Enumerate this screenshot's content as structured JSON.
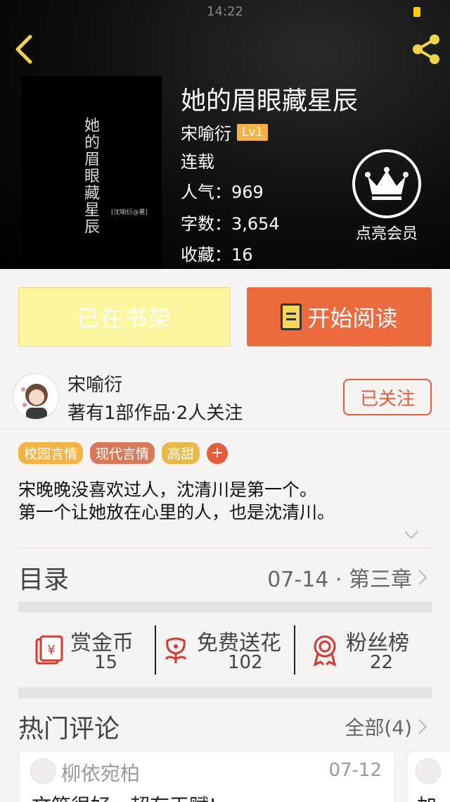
{
  "status_bar": {
    "time": "14:22"
  },
  "header": {
    "back_icon": "chevron-left-icon",
    "share_icon": "share-icon",
    "cover": {
      "title": "她的眉眼藏星辰",
      "author_text": "[沈喻衍@著]"
    },
    "title": "她的眉眼藏星辰",
    "author": "宋喻衍",
    "level": "Lv1",
    "status": "连载",
    "popularity": "人气：969",
    "word_count": "字数：3,654",
    "favorites": "收藏：16",
    "vip_label": "点亮会员",
    "vip_icon": "crown-icon"
  },
  "actions": {
    "shelf_label": "已在书架",
    "read_label": "开始阅读"
  },
  "author_row": {
    "name": "宋喻衍",
    "stats": "著有1部作品·2人关注",
    "follow_label": "已关注"
  },
  "tags": [
    {
      "label": "校园言情",
      "color": "#f4b345"
    },
    {
      "label": "现代言情",
      "color": "#d77a5c"
    },
    {
      "label": "高甜",
      "color": "#e7b94c"
    }
  ],
  "tag_add": "+",
  "synopsis": {
    "line1": "宋晚晚没喜欢过人，沈清川是第一个。",
    "line2": "第一个让她放在心里的人，也是沈清川。"
  },
  "toc": {
    "title": "目录",
    "latest": "07-14 · 第三章"
  },
  "stats": {
    "reward": {
      "label": "赏金币",
      "value": "15",
      "icon": "red-envelope-icon"
    },
    "flower": {
      "label": "免费送花",
      "value": "102",
      "icon": "flower-icon"
    },
    "fans": {
      "label": "粉丝榜",
      "value": "22",
      "icon": "medal-icon"
    }
  },
  "comments": {
    "title": "热门评论",
    "all_label": "全部(4)",
    "items": [
      {
        "user": "柳依宛柏",
        "date": "07-12",
        "text": "文笔很好，超有天赋!"
      },
      {
        "text": "加"
      }
    ]
  },
  "colors": {
    "accent_orange": "#ec6a3d",
    "follow_red": "#e45c3c",
    "shelf_yellow": "#fdf6a0"
  }
}
